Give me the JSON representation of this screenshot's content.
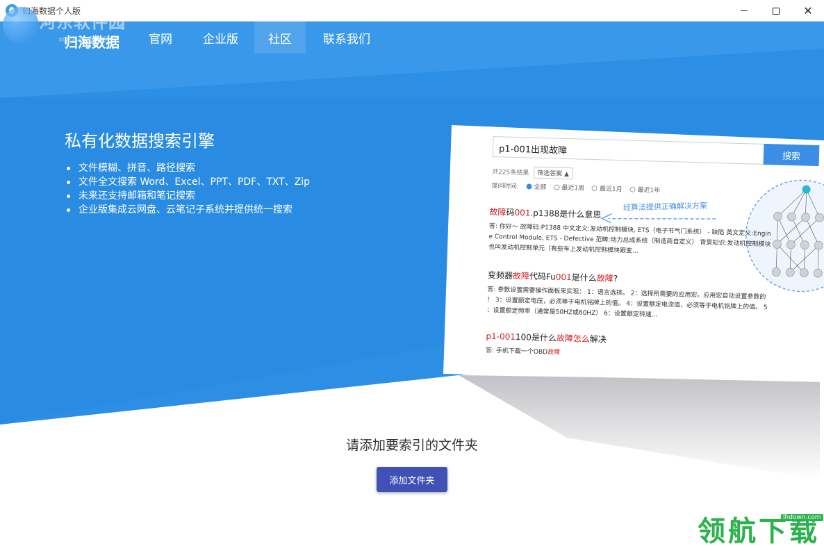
{
  "window": {
    "title": "归海数据个人版",
    "minimize_label": "—",
    "maximize_label": "□",
    "close_label": "✕"
  },
  "watermark_top": {
    "text": "河东软件园",
    "url": "www.pc0359.cn"
  },
  "nav": {
    "brand": "归海数据",
    "items": [
      {
        "label": "官网"
      },
      {
        "label": "企业版"
      },
      {
        "label": "社区",
        "active": true
      },
      {
        "label": "联系我们"
      }
    ]
  },
  "hero": {
    "title": "私有化数据搜索引擎",
    "features": [
      "文件模糊、拼音、路径搜索",
      "文件全文搜索 Word、Excel、PPT、PDF、TXT、Zip",
      "未来还支持邮箱和笔记搜索",
      "企业版集成云网盘、云笔记子系统并提供统一搜索"
    ]
  },
  "preview": {
    "search_value": "p1-001出现故障",
    "search_button": "搜索",
    "result_count": "共225条结果",
    "filter_label": "筛选答案 ▲",
    "time_label": "提问时间:",
    "time_options": [
      "全部",
      "最近1周",
      "最近1月",
      "最近1年"
    ],
    "algo_label": "经算法提供正确解决方案",
    "results": [
      {
        "title_hl": "故障",
        "title_mid": "码",
        "title_hl2": "001",
        "title_rest": ".p1388是什么意思",
        "body_1": "答: 你好～ 故障码:P1388 中文定义:发动机控制模块, ETS（电子节气门系统） - 缺陷 英文定义:Engin",
        "body_2": "e Control Module, ETS - Defective 范畴:动力总成系统（制造商自定义） 背景知识:发动机控制模块",
        "body_3": "也叫发动机控制单元（有些车上发动机控制模块跟变..."
      },
      {
        "title_pre": "变频器",
        "title_hl": "故障",
        "title_mid": "代码Fu",
        "title_hl2": "001",
        "title_rest": "是什么",
        "title_hl3": "故障",
        "title_end": "?",
        "body_1": "答: 参数设置需要操作面板来实现： 1：语言选择。 2：选择所需要的应用宏。应用宏自动设置参数的",
        "body_2": "！ 3：设置额定电压，必须等于电机铭牌上的值。 4：设置额定电流值，必须等于电机铭牌上的值。 5",
        "body_3": "：设置额定频率（通常是50HZ或60HZ） 6：设置额定转速..."
      },
      {
        "title_hl": "p1-001",
        "title_mid": "100是什么",
        "title_hl2": "故障怎么",
        "title_rest": "解决",
        "body_pre": "答: 手机下载一个OBD",
        "body_hl": "故障"
      }
    ]
  },
  "bottom": {
    "prompt": "请添加要索引的文件夹",
    "add_button": "添加文件夹"
  },
  "watermark_bottom": {
    "text": "领航下载",
    "url": "lhdown.com"
  },
  "colors": {
    "hero_blue": "#2d8fe4",
    "button_indigo": "#3f51b5",
    "highlight_red": "#d01c1c",
    "watermark_green": "#2bb24c"
  }
}
